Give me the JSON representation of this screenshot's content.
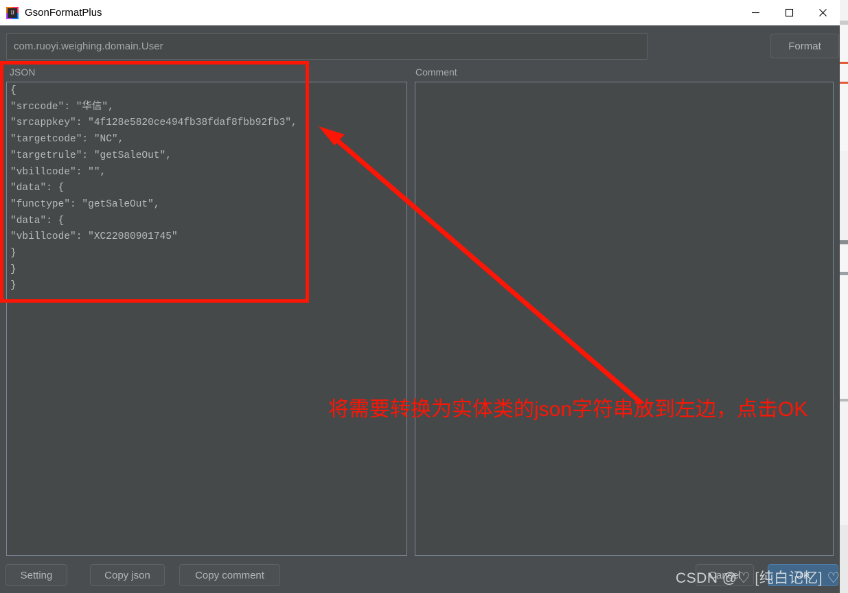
{
  "window": {
    "title": "GsonFormatPlus",
    "app_icon": "intellij-idea-icon",
    "controls": {
      "minimize": "minimize-icon",
      "maximize": "maximize-icon",
      "close": "close-icon"
    }
  },
  "toolbar": {
    "class_name_value": "com.ruoyi.weighing.domain.User",
    "class_name_placeholder": "",
    "format_label": "Format"
  },
  "panels": {
    "json_label": "JSON",
    "comment_label": "Comment",
    "json_value": "{\n\"srccode\": \"华信\",\n\"srcappkey\": \"4f128e5820ce494fb38fdaf8fbb92fb3\",\n\"targetcode\": \"NC\",\n\"targetrule\": \"getSaleOut\",\n\"vbillcode\": \"\",\n\"data\": {\n\"functype\": \"getSaleOut\",\n\"data\": {\n\"vbillcode\": \"XC22080901745\"\n}\n}\n}",
    "comment_value": ""
  },
  "buttons": {
    "setting": "Setting",
    "copy_json": "Copy  json",
    "copy_comment": "Copy comment",
    "cancel": "Cancel",
    "ok": "OK"
  },
  "annotation": {
    "text": "将需要转换为实体类的json字符串放到左边，点击OK",
    "color": "#fb1606",
    "shapes": [
      "highlight-rectangle",
      "pointer-arrow"
    ]
  },
  "watermark": {
    "text": "CSDN @♡  [纯白记忆]  ♡"
  },
  "colors": {
    "dialog_background": "#4a4d4f",
    "field_background": "#45494a",
    "button_background": "#4c5052",
    "accent_ok": "#41688b",
    "text_primary": "#b3b6b8",
    "annotation_red": "#fb1606"
  }
}
